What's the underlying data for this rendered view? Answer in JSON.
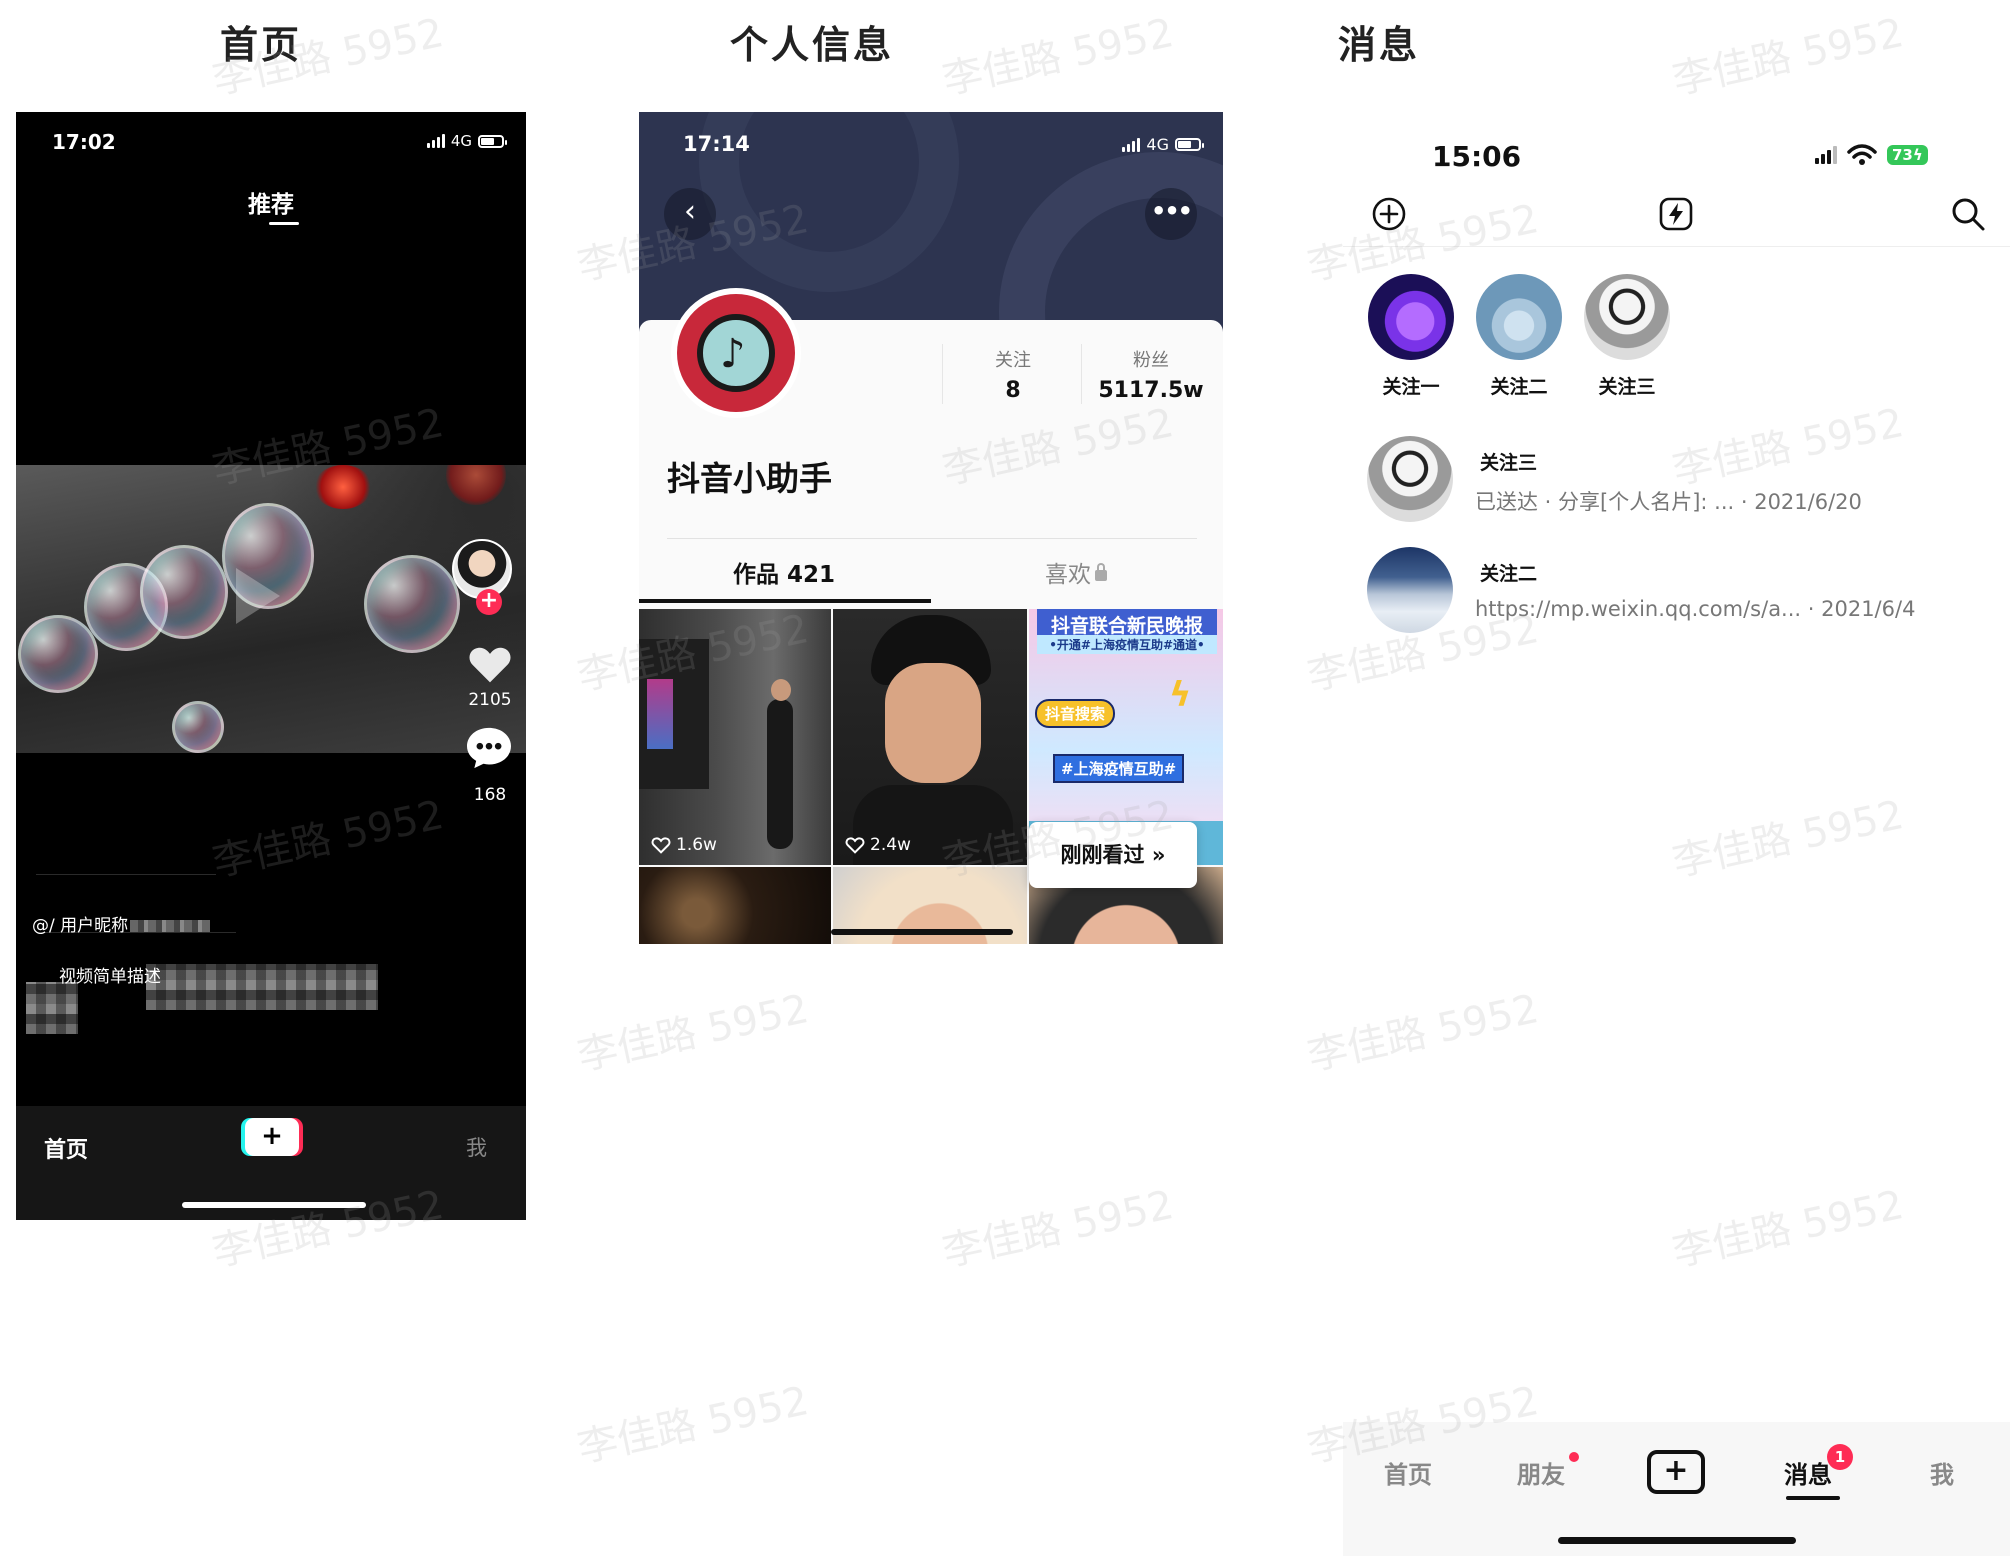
{
  "sections": {
    "home_title": "首页",
    "profile_title": "个人信息",
    "messages_title": "消息"
  },
  "watermark": "李佳路 5952",
  "home": {
    "time": "17:02",
    "network": "4G",
    "tab": "推荐",
    "likes": "2105",
    "comments": "168",
    "nickname": "@/  用户昵称",
    "description": "视频简单描述",
    "nav": {
      "home": "首页",
      "plus": "+",
      "me": "我"
    },
    "icons": [
      "heart-icon",
      "comment-icon",
      "plus-icon"
    ]
  },
  "profile": {
    "time": "17:14",
    "network": "4G",
    "back": "‹",
    "more": "•••",
    "following_label": "关注",
    "following_value": "8",
    "fans_label": "粉丝",
    "fans_value": "5117.5w",
    "name": "抖音小助手",
    "tab_works": "作品 421",
    "tab_likes": "喜欢",
    "grid": [
      {
        "likes": "1.6w"
      },
      {
        "likes": "2.4w"
      },
      {
        "poster_title": "抖音联合新民晚报",
        "poster_sub": "•开通#上海疫情互助#通道•",
        "poster_tag": "抖音搜索",
        "poster_hash": "#上海疫情互助#"
      }
    ],
    "recently_viewed": "刚刚看过 »"
  },
  "messages": {
    "time": "15:06",
    "battery": "73",
    "stories": [
      {
        "name": "关注一"
      },
      {
        "name": "关注二"
      },
      {
        "name": "关注三"
      }
    ],
    "conversations": [
      {
        "name": "关注三",
        "preview": "已送达 · 分享[个人名片]: ...  · 2021/6/20"
      },
      {
        "name": "关注二",
        "preview": "https://mp.weixin.qq.com/s/a... · 2021/6/4"
      }
    ],
    "nav": {
      "home": "首页",
      "friends": "朋友",
      "plus": "+",
      "messages": "消息",
      "messages_badge": "1",
      "me": "我"
    },
    "accent": "#fe2c55"
  }
}
